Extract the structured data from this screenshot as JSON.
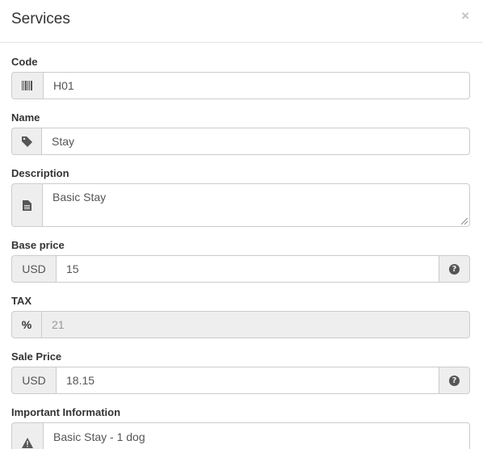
{
  "modal": {
    "title": "Services",
    "close_label": "×"
  },
  "fields": {
    "code": {
      "label": "Code",
      "value": "H01",
      "icon": "barcode-icon"
    },
    "name": {
      "label": "Name",
      "value": "Stay",
      "icon": "tag-icon"
    },
    "description": {
      "label": "Description",
      "value": "Basic Stay",
      "icon": "file-icon"
    },
    "base_price": {
      "label": "Base price",
      "currency": "USD",
      "value": "15",
      "help_icon": "question-circle-icon"
    },
    "tax": {
      "label": "TAX",
      "unit": "%",
      "value": "21",
      "disabled": true
    },
    "sale_price": {
      "label": "Sale Price",
      "currency": "USD",
      "value": "18.15",
      "help_icon": "question-circle-icon"
    },
    "important_information": {
      "label": "Important Information",
      "value": "Basic Stay - 1 dog",
      "icon": "warning-icon"
    }
  }
}
